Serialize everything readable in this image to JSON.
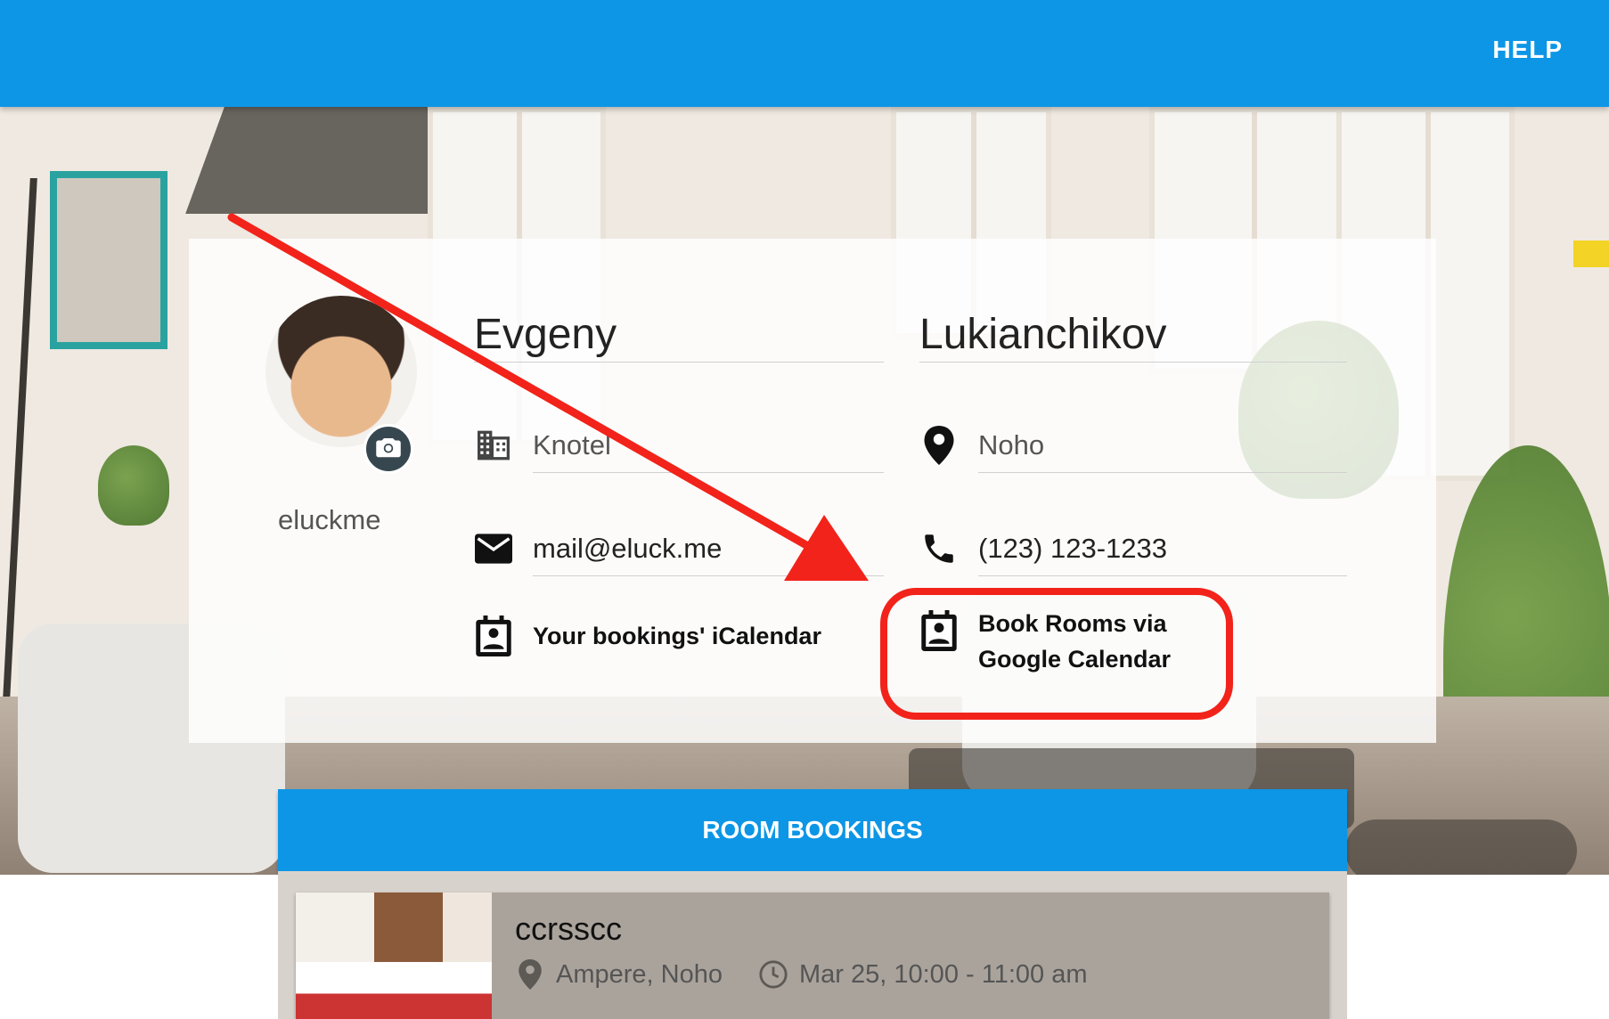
{
  "topbar": {
    "help_label": "HELP"
  },
  "profile": {
    "username": "eluckme",
    "first_name": "Evgeny",
    "last_name": "Lukianchikov",
    "company": "Knotel",
    "location": "Noho",
    "email": "mail@eluck.me",
    "phone": "(123) 123-1233",
    "icalendar_label": "Your bookings' iCalendar",
    "google_calendar_label_line1": "Book Rooms via",
    "google_calendar_label_line2": "Google Calendar"
  },
  "bookings": {
    "title": "ROOM BOOKINGS",
    "items": [
      {
        "name": "ccrsscc",
        "location": "Ampere, Noho",
        "time": "Mar 25, 10:00 - 11:00 am"
      }
    ]
  },
  "colors": {
    "brand": "#0d96e6",
    "annotation": "#f2231a"
  },
  "icons": [
    "camera-icon",
    "building-icon",
    "location-pin-icon",
    "mail-icon",
    "phone-icon",
    "calendar-contact-icon",
    "clock-icon"
  ]
}
